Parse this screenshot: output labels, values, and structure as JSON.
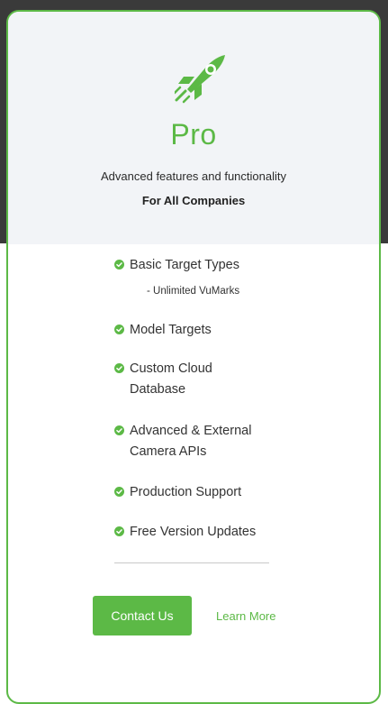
{
  "plan": {
    "name": "Pro",
    "description": "Advanced features and functionality",
    "audience": "For All Companies"
  },
  "features": [
    {
      "label": "Basic Target Types",
      "sub": "- Unlimited VuMarks"
    },
    {
      "label": "Model Targets"
    },
    {
      "label_lines": [
        "Custom Cloud",
        "Database"
      ]
    },
    {
      "label_lines": [
        "Advanced & External",
        "Camera APIs"
      ]
    },
    {
      "label": "Production Support"
    },
    {
      "label": "Free Version Updates"
    }
  ],
  "actions": {
    "contact_label": "Contact Us",
    "learn_more_label": "Learn More"
  },
  "colors": {
    "accent": "#5cb946",
    "header_bg": "#f2f4f7",
    "page_dark": "#3a3a3a"
  },
  "icons": {
    "plan": "rocket-icon",
    "feature": "check-circle-icon"
  }
}
